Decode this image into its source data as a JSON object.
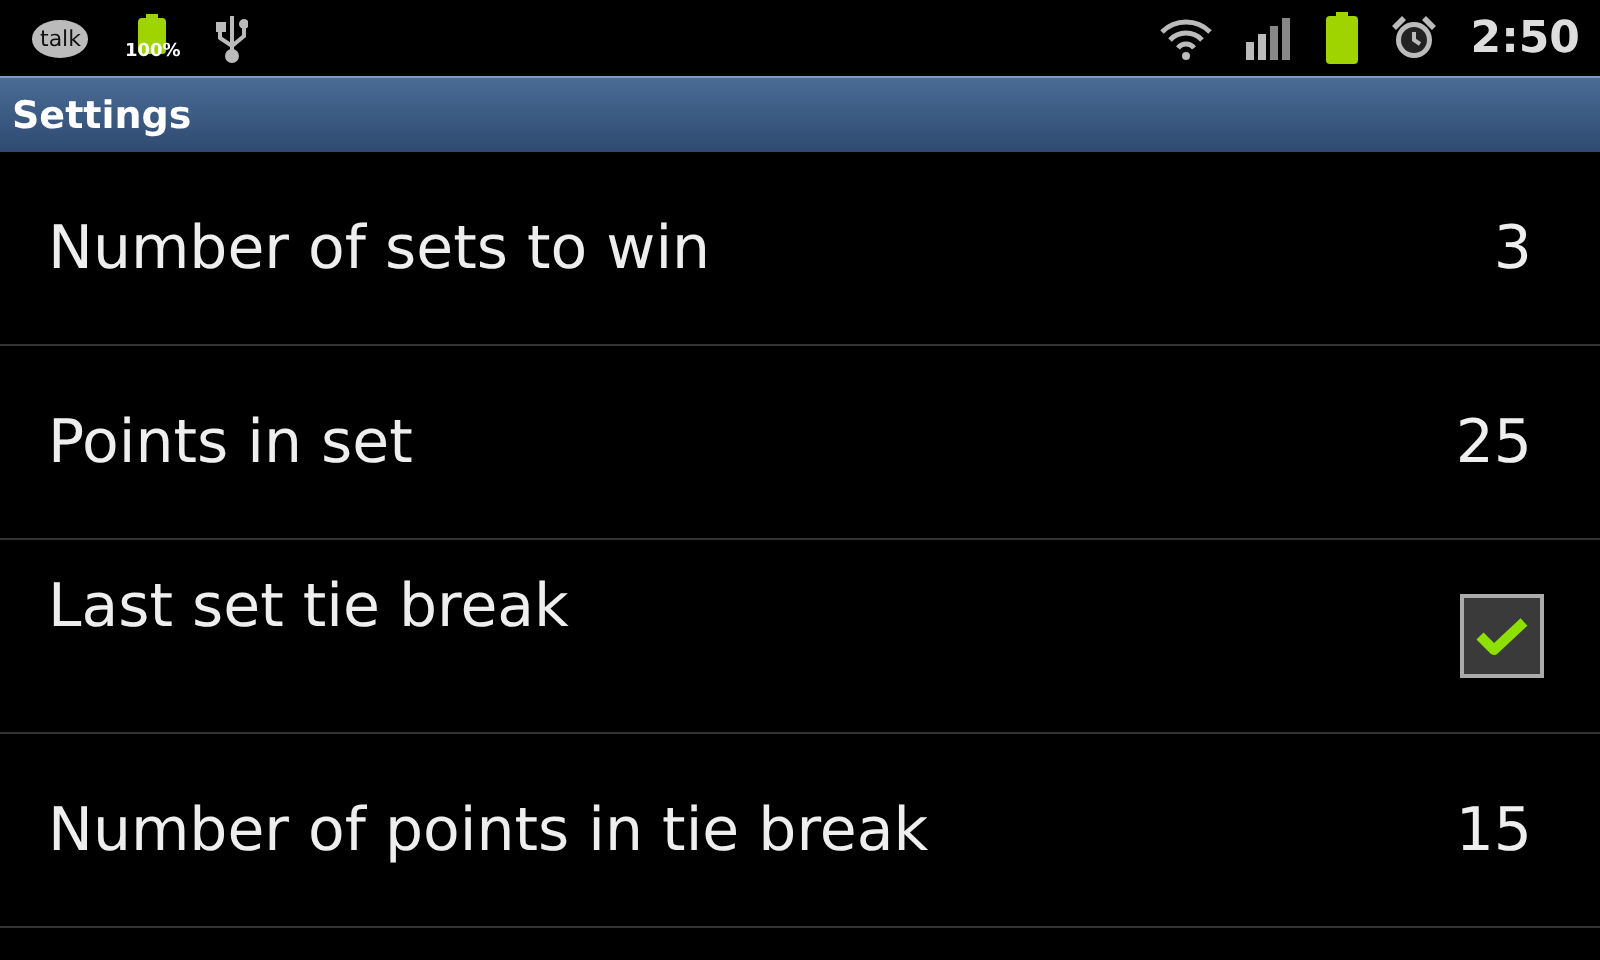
{
  "status_bar": {
    "talk_label": "talk",
    "battery_percent": "100%",
    "time": "2:50"
  },
  "title_bar": {
    "title": "Settings"
  },
  "settings": [
    {
      "kind": "value",
      "label": "Number of sets to win",
      "value": "3"
    },
    {
      "kind": "value",
      "label": "Points in set",
      "value": "25"
    },
    {
      "kind": "checkbox",
      "label": "Last set tie break",
      "checked": true
    },
    {
      "kind": "value",
      "label": "Number of points in tie break",
      "value": "15"
    }
  ]
}
